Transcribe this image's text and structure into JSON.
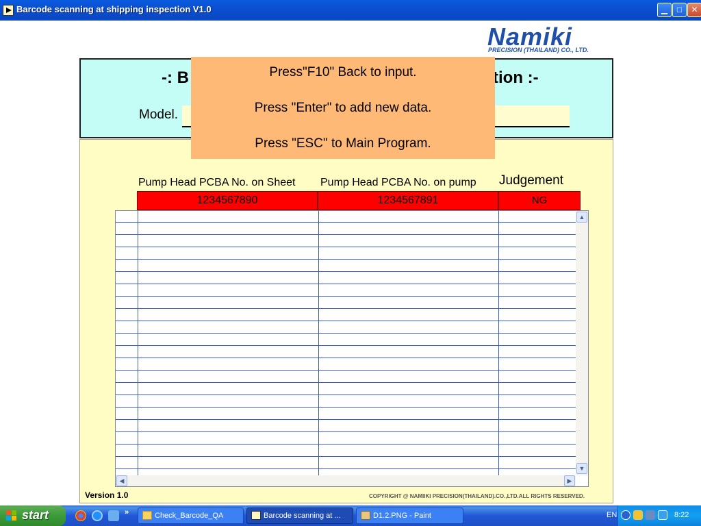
{
  "window": {
    "title": "Barcode scanning at shipping inspection V1.0",
    "min_glyph": "▁",
    "max_glyph": "□",
    "close_glyph": "✕"
  },
  "logo": {
    "main": "Namiki",
    "sub": "PRECISION (THAILAND) CO., LTD."
  },
  "header": {
    "title_left": "-: B",
    "title_right": "tion :-",
    "model_label": "Model. C",
    "model_value": ""
  },
  "overlay": {
    "line1": "Press\"F10\" Back to input.",
    "line2": "Press \"Enter\" to add new data.",
    "line3": "Press \"ESC\" to Main Program."
  },
  "table": {
    "columns": [
      "Pump Head PCBA No. on Sheet",
      "Pump Head PCBA No. on pump",
      "Judgement"
    ],
    "current": {
      "sheet": "1234567890",
      "pump": "1234567891",
      "judgement": "NG"
    },
    "scroll_up": "▲",
    "scroll_down": "▼",
    "scroll_left": "◀",
    "scroll_right": "▶"
  },
  "footer": {
    "version": "Version 1.0",
    "copyright": "COPYRIGHT @    NAMIIKI PRECISION(THAILAND).CO.,LTD.ALL RIGHTS RESERVED."
  },
  "taskbar": {
    "start": "start",
    "chevron": "»",
    "tasks": [
      {
        "label": "Check_Barcode_QA",
        "icon": "folder-icon"
      },
      {
        "label": "Barcode scanning at ...",
        "icon": "labview-icon"
      },
      {
        "label": "D1.2.PNG - Paint",
        "icon": "paint-icon"
      }
    ],
    "language": "EN",
    "clock": "8:22"
  },
  "colors": {
    "titlebar": "#0b4fd0",
    "header_panel": "#c4fcf6",
    "main_panel": "#fffdc4",
    "overlay": "#ffb977",
    "ng_red": "#ff0000",
    "grid_line": "#3c5fb4",
    "logo_blue": "#1f4fa8"
  }
}
